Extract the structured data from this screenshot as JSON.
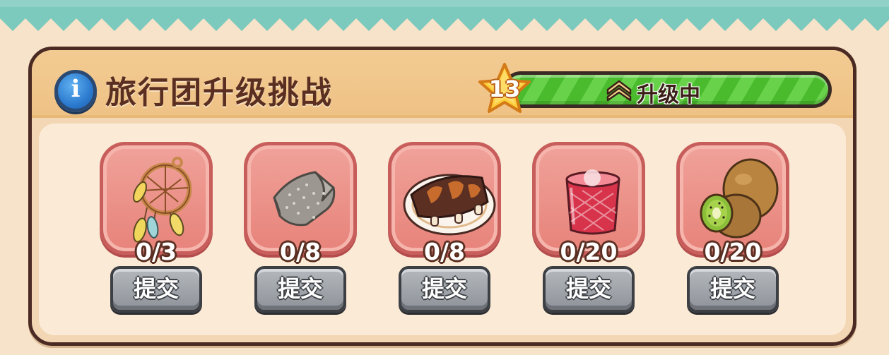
{
  "header": {
    "title": "旅行团升级挑战",
    "info_icon": "info-icon",
    "level": "13",
    "progress_label": "升级中",
    "progress_fraction": 1.0,
    "progress_color": "#5bc93c"
  },
  "items": [
    {
      "name": "dreamcatcher",
      "count": "0/3",
      "button": "提交"
    },
    {
      "name": "cloth",
      "count": "0/8",
      "button": "提交"
    },
    {
      "name": "ribs",
      "count": "0/8",
      "button": "提交"
    },
    {
      "name": "red-drink",
      "count": "0/20",
      "button": "提交"
    },
    {
      "name": "kiwi",
      "count": "0/20",
      "button": "提交"
    }
  ]
}
